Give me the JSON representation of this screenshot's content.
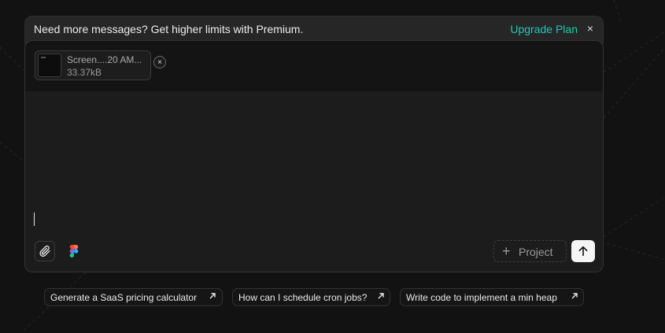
{
  "banner": {
    "message": "Need more messages? Get higher limits with Premium.",
    "upgrade_label": "Upgrade Plan",
    "close_glyph": "×"
  },
  "attachment": {
    "file_name": "Screen....20 AM...",
    "file_size": "33.37kB",
    "remove_glyph": "×"
  },
  "composer": {
    "text_value": "",
    "project_label": "Project",
    "project_icon": "plus-icon",
    "attach_icon": "paperclip-icon",
    "figma_icon": "figma-icon",
    "send_icon": "arrow-up-icon"
  },
  "suggestions": [
    {
      "label": "Generate a SaaS pricing calculator",
      "icon": "arrow-up-right-icon"
    },
    {
      "label": "How can I schedule cron jobs?",
      "icon": "arrow-up-right-icon"
    },
    {
      "label": "Write code to implement a min heap",
      "icon": "arrow-up-right-icon"
    }
  ],
  "colors": {
    "accent": "#20c9b3",
    "background": "#121212",
    "surface": "#1c1c1c",
    "send_button": "#f5f5f5"
  }
}
